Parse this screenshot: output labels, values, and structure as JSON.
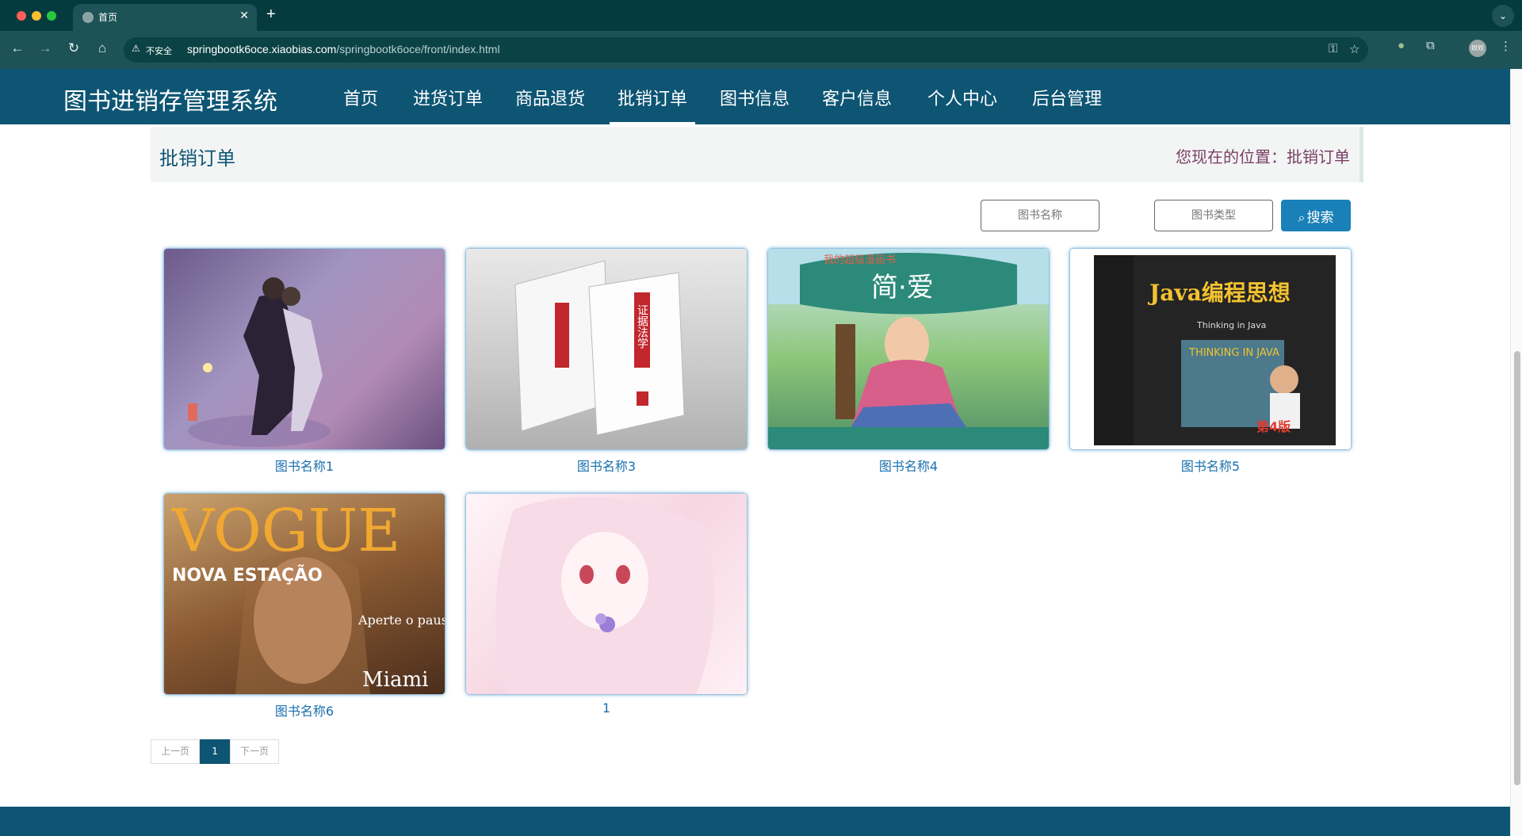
{
  "browser": {
    "tab_title": "首页",
    "tab_close": "✕",
    "new_tab": "+",
    "tab_menu": "⌄",
    "insecure_label": "不安全",
    "url_host": "springbootk6oce.xiaobias.com",
    "url_path": "/springbootk6oce/front/index.html",
    "profile": "奴奴"
  },
  "site": {
    "title": "图书进销存管理系统",
    "nav": [
      "首页",
      "进货订单",
      "商品退货",
      "批销订单",
      "图书信息",
      "客户信息",
      "个人中心",
      "后台管理"
    ],
    "active_nav": "批销订单"
  },
  "page": {
    "title": "批销订单",
    "location": "您现在的位置：批销订单"
  },
  "search": {
    "name_placeholder": "图书名称",
    "type_placeholder": "图书类型",
    "button_label": "搜索"
  },
  "books": [
    {
      "label": "图书名称1"
    },
    {
      "label": "图书名称3"
    },
    {
      "label": "图书名称4"
    },
    {
      "label": "图书名称5"
    },
    {
      "label": "图书名称6"
    },
    {
      "label": "1"
    }
  ],
  "covers": {
    "book3_title": "证据法学",
    "book4_title": "简·爱",
    "book4_series": "我的超级漫画书",
    "book5_title": "Java编程思想",
    "book5_sub": "Thinking in Java",
    "book5_art": "THINKING IN JAVA",
    "book5_edition": "第4版",
    "book6_masthead": "VOGUE",
    "book6_cover_text": "NOVA ESTAÇÃO",
    "book6_cover_text2": "Aperte o pause",
    "book6_cover_text3": "Miami"
  },
  "pagination": {
    "prev": "上一页",
    "current": "1",
    "next": "下一页"
  },
  "colors": {
    "header": "#0d5573",
    "accent": "#1a80b8",
    "browser_frame": "#053b3f"
  }
}
